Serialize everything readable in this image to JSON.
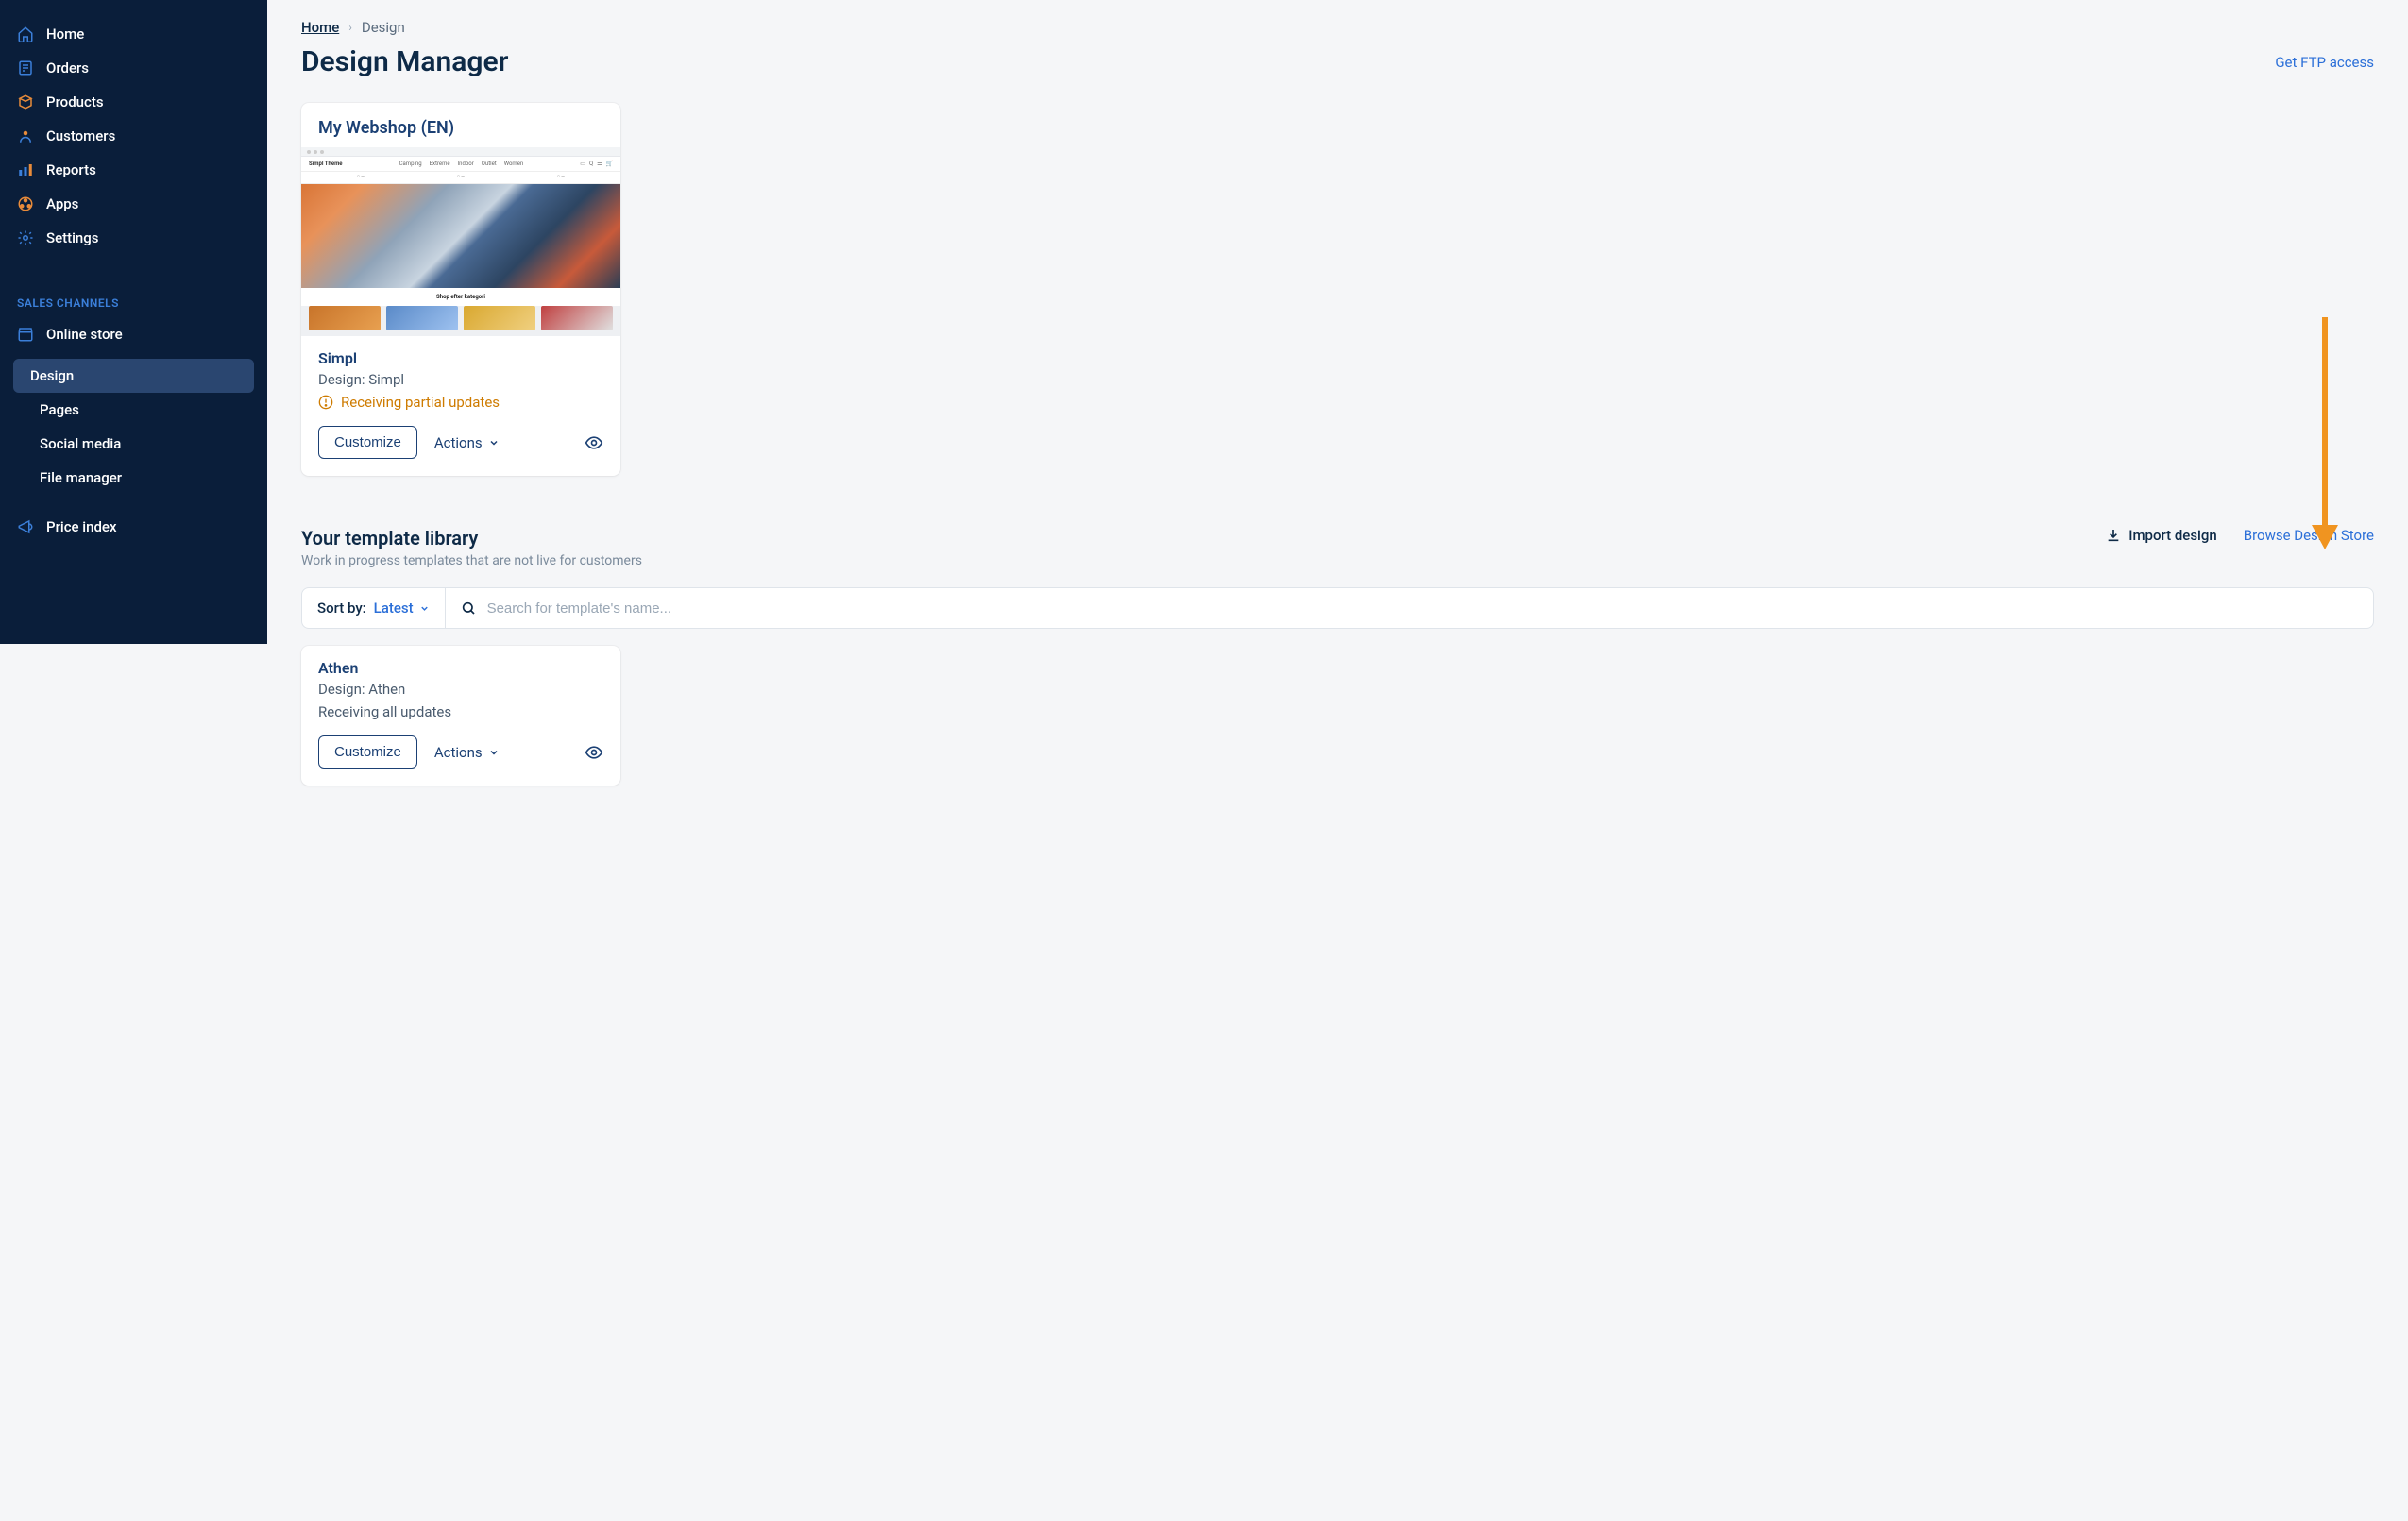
{
  "sidebar": {
    "main": [
      {
        "label": "Home",
        "icon": "home"
      },
      {
        "label": "Orders",
        "icon": "orders"
      },
      {
        "label": "Products",
        "icon": "products"
      },
      {
        "label": "Customers",
        "icon": "customers"
      },
      {
        "label": "Reports",
        "icon": "reports"
      },
      {
        "label": "Apps",
        "icon": "apps"
      },
      {
        "label": "Settings",
        "icon": "settings"
      }
    ],
    "section_label": "SALES CHANNELS",
    "online_store": "Online store",
    "sub": [
      {
        "label": "Design"
      },
      {
        "label": "Pages"
      },
      {
        "label": "Social media"
      },
      {
        "label": "File manager"
      }
    ],
    "price_index": "Price index"
  },
  "breadcrumb": {
    "home": "Home",
    "current": "Design"
  },
  "page": {
    "title": "Design Manager",
    "ftp_link": "Get FTP access"
  },
  "shop_card": {
    "title": "My Webshop (EN)",
    "preview": {
      "brand": "Simpl Theme",
      "menu": [
        "Camping",
        "Extreme",
        "Indoor",
        "Outlet",
        "Women"
      ],
      "category_label": "Shop efter kategori"
    },
    "theme": "Simpl",
    "design_line": "Design: Simpl",
    "status": "Receiving partial updates",
    "customize": "Customize",
    "actions": "Actions"
  },
  "library": {
    "title": "Your template library",
    "subtitle": "Work in progress templates that are not live for customers",
    "import": "Import design",
    "browse": "Browse Design Store",
    "sort_label": "Sort by:",
    "sort_value": "Latest",
    "search_placeholder": "Search for template's name..."
  },
  "template_card": {
    "theme": "Athen",
    "design_line": "Design: Athen",
    "status": "Receiving all updates",
    "customize": "Customize",
    "actions": "Actions"
  }
}
